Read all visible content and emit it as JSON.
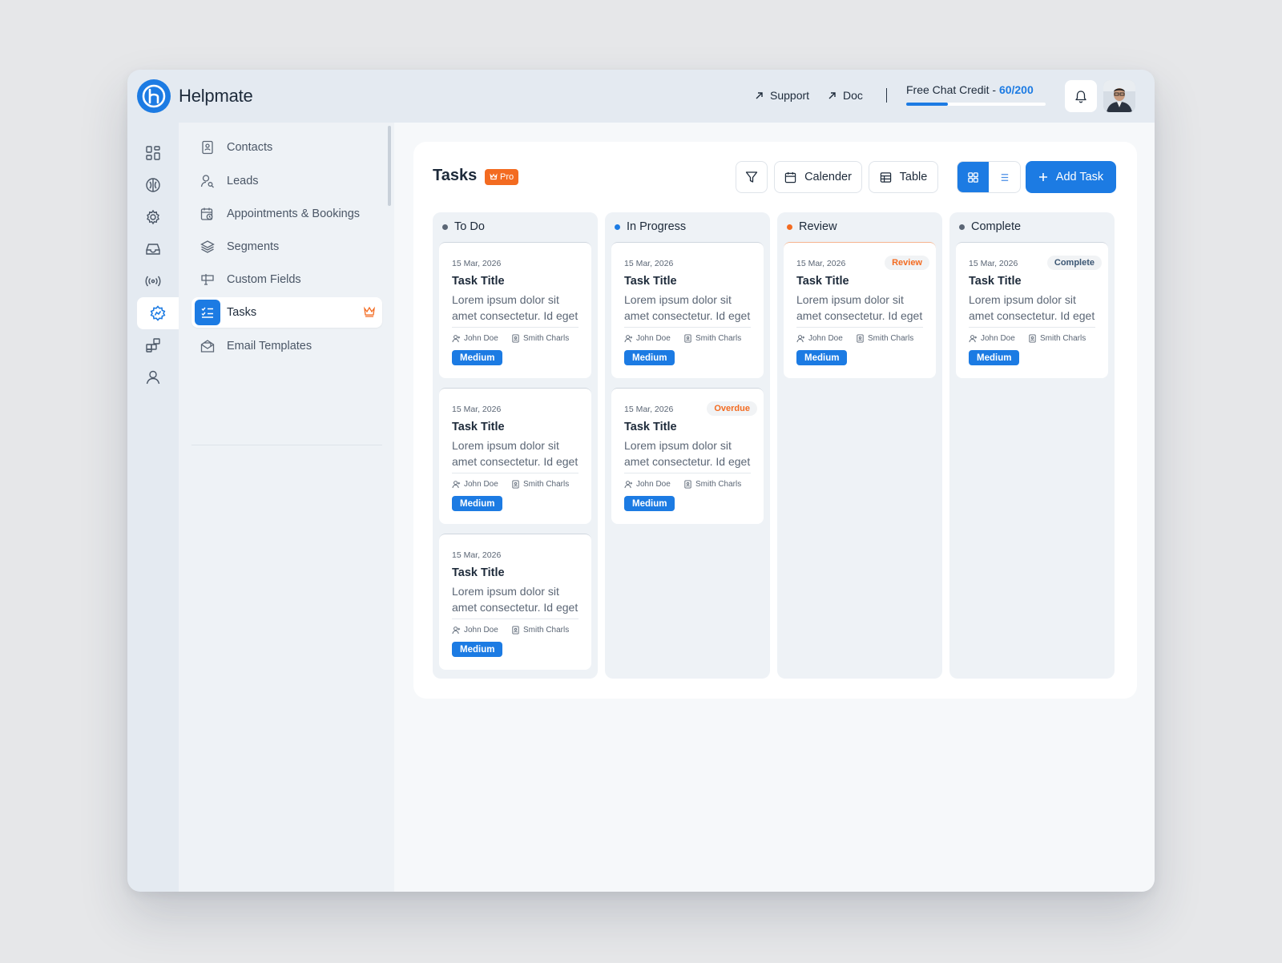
{
  "app": {
    "brand": "Helpmate",
    "links": {
      "support": "Support",
      "doc": "Doc"
    },
    "credit": {
      "label": "Free Chat Credit - ",
      "value": "60/200",
      "used_fraction": 0.3
    }
  },
  "rail": {
    "icons": [
      "dashboard-icon",
      "brain-icon",
      "settings-icon",
      "inbox-icon",
      "broadcast-icon",
      "crm-icon",
      "apps-icon",
      "profile-icon"
    ]
  },
  "sidebar": {
    "items": [
      {
        "label": "Contacts",
        "icon": "contact-card-icon"
      },
      {
        "label": "Leads",
        "icon": "lead-search-icon"
      },
      {
        "label": "Appointments & Bookings",
        "icon": "calendar-clock-icon"
      },
      {
        "label": "Segments",
        "icon": "layers-icon"
      },
      {
        "label": "Custom Fields",
        "icon": "custom-field-icon"
      },
      {
        "label": "Tasks",
        "icon": "task-list-icon",
        "active": true
      },
      {
        "label": "Email Templates",
        "icon": "email-template-icon"
      }
    ]
  },
  "page": {
    "title": "Tasks",
    "pro_badge": "Pro",
    "toolbar": {
      "calendar": "Calender",
      "table": "Table",
      "add_task": "Add Task"
    }
  },
  "colors": {
    "accent": "#1c7be3",
    "orange": "#f36b21",
    "todo_dot": "#5b6675",
    "progress_dot": "#1c7be3",
    "review_dot": "#f36b21",
    "complete_dot": "#5b6675"
  },
  "board": {
    "columns": [
      {
        "name": "To Do",
        "cards": [
          {
            "date": "15 Mar, 2026",
            "title": "Task Title",
            "desc1": "Lorem ipsum dolor sit",
            "desc2": "amet consectetur. Id eget",
            "assignee": "John Doe",
            "client": "Smith Charls",
            "priority": "Medium"
          },
          {
            "date": "15 Mar, 2026",
            "title": "Task Title",
            "desc1": "Lorem ipsum dolor sit",
            "desc2": "amet consectetur. Id eget",
            "assignee": "John Doe",
            "client": "Smith Charls",
            "priority": "Medium"
          },
          {
            "date": "15 Mar, 2026",
            "title": "Task Title",
            "desc1": "Lorem ipsum dolor sit",
            "desc2": "amet consectetur. Id eget",
            "assignee": "John Doe",
            "client": "Smith Charls",
            "priority": "Medium"
          }
        ]
      },
      {
        "name": "In Progress",
        "cards": [
          {
            "date": "15 Mar, 2026",
            "title": "Task Title",
            "desc1": "Lorem ipsum dolor sit",
            "desc2": "amet consectetur. Id eget",
            "assignee": "John Doe",
            "client": "Smith Charls",
            "priority": "Medium"
          },
          {
            "date": "15 Mar, 2026",
            "badge": "Overdue",
            "title": "Task Title",
            "desc1": "Lorem ipsum dolor sit",
            "desc2": "amet consectetur. Id eget",
            "assignee": "John Doe",
            "client": "Smith Charls",
            "priority": "Medium"
          }
        ]
      },
      {
        "name": "Review",
        "cards": [
          {
            "date": "15 Mar, 2026",
            "badge": "Review",
            "title": "Task Title",
            "desc1": "Lorem ipsum dolor sit",
            "desc2": "amet consectetur. Id eget",
            "assignee": "John Doe",
            "client": "Smith Charls",
            "priority": "Medium"
          }
        ]
      },
      {
        "name": "Complete",
        "cards": [
          {
            "date": "15 Mar, 2026",
            "badge": "Complete",
            "title": "Task Title",
            "desc1": "Lorem ipsum dolor sit",
            "desc2": "amet consectetur. Id eget",
            "assignee": "John Doe",
            "client": "Smith Charls",
            "priority": "Medium"
          }
        ]
      }
    ]
  }
}
